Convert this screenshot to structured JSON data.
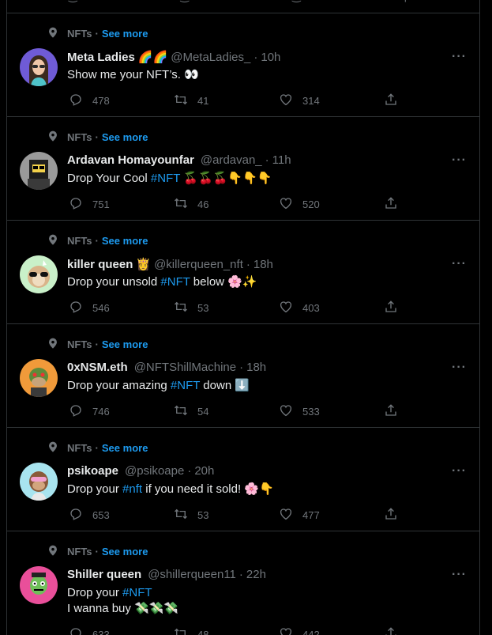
{
  "top_stub": {
    "counts": [
      "",
      "",
      "",
      ""
    ]
  },
  "tweets": [
    {
      "context": "NFTs",
      "see_more": "See more",
      "name": "Meta Ladies",
      "name_emoji": "🌈🌈",
      "handle": "@MetaLadies_",
      "time": "10h",
      "text_parts": [
        {
          "t": "Show me your NFT’s. 👀",
          "tag": false
        }
      ],
      "replies": "478",
      "retweets": "41",
      "likes": "314",
      "avatar": "meta-ladies"
    },
    {
      "context": "NFTs",
      "see_more": "See more",
      "name": "Ardavan Homayounfar",
      "name_emoji": "",
      "handle": "@ardavan_",
      "time": "11h",
      "text_parts": [
        {
          "t": "Drop Your Cool ",
          "tag": false
        },
        {
          "t": "#NFT",
          "tag": true
        },
        {
          "t": " 🍒🍒🍒👇👇👇",
          "tag": false
        }
      ],
      "replies": "751",
      "retweets": "46",
      "likes": "520",
      "avatar": "ardavan"
    },
    {
      "context": "NFTs",
      "see_more": "See more",
      "name": "killer queen",
      "name_emoji": "👸",
      "handle": "@killerqueen_nft",
      "time": "18h",
      "text_parts": [
        {
          "t": "Drop your unsold ",
          "tag": false
        },
        {
          "t": "#NFT",
          "tag": true
        },
        {
          "t": " below 🌸✨",
          "tag": false
        }
      ],
      "replies": "546",
      "retweets": "53",
      "likes": "403",
      "avatar": "killer-queen"
    },
    {
      "context": "NFTs",
      "see_more": "See more",
      "name": "0xNSM.eth",
      "name_emoji": "",
      "handle": "@NFTShillMachine",
      "time": "18h",
      "text_parts": [
        {
          "t": "Drop your amazing ",
          "tag": false
        },
        {
          "t": "#NFT",
          "tag": true
        },
        {
          "t": " down ⬇️",
          "tag": false
        }
      ],
      "replies": "746",
      "retweets": "54",
      "likes": "533",
      "avatar": "nsm"
    },
    {
      "context": "NFTs",
      "see_more": "See more",
      "name": "psikoape",
      "name_emoji": "",
      "handle": "@psikoape",
      "time": "20h",
      "text_parts": [
        {
          "t": "Drop your ",
          "tag": false
        },
        {
          "t": "#nft",
          "tag": true
        },
        {
          "t": " if you need it sold! 🌸👇",
          "tag": false
        }
      ],
      "replies": "653",
      "retweets": "53",
      "likes": "477",
      "avatar": "psikoape"
    },
    {
      "context": "NFTs",
      "see_more": "See more",
      "name": "Shiller queen",
      "name_emoji": "",
      "handle": "@shillerqueen11",
      "time": "22h",
      "text_parts": [
        {
          "t": "Drop your ",
          "tag": false
        },
        {
          "t": "#NFT",
          "tag": true
        },
        {
          "t": "\nI wanna buy 💸💸💸",
          "tag": false
        }
      ],
      "replies": "633",
      "retweets": "48",
      "likes": "442",
      "avatar": "shiller-queen"
    }
  ],
  "colors": {
    "background": "#000000",
    "border": "#2f3336",
    "text_primary": "#e7e9ea",
    "text_secondary": "#71767b",
    "accent": "#1d9bf0"
  },
  "icons": {
    "context": "topic-icon",
    "more": "more-icon",
    "reply": "reply-icon",
    "retweet": "retweet-icon",
    "like": "heart-icon",
    "share": "share-icon"
  }
}
